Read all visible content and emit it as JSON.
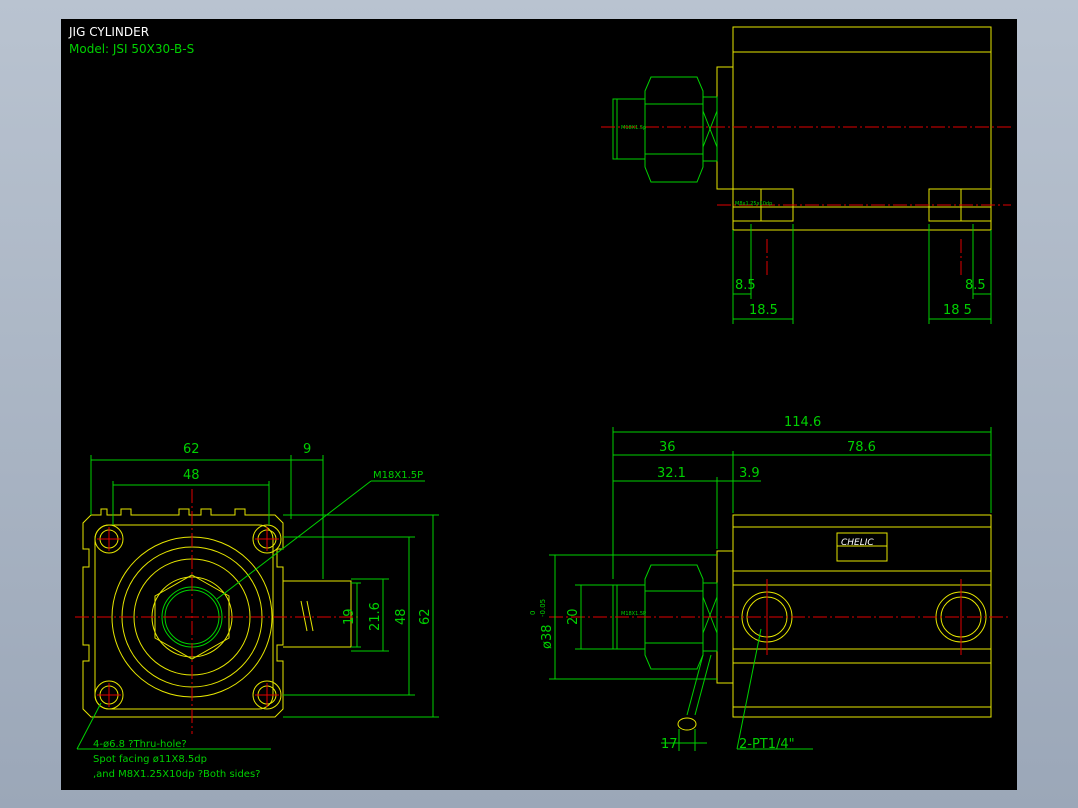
{
  "title": "JIG CYLINDER",
  "model": "Model: JSI 50X30-B-S",
  "side_view": {
    "dim_left_small": "8.5",
    "dim_left_big": "18.5",
    "dim_right_small": "8.5",
    "dim_right_big": "18 5",
    "rod_label": "M18X1.5p",
    "bolt_label": "M8x1.25x10dp"
  },
  "front_view": {
    "dim_62_top": "62",
    "dim_48_top": "48",
    "dim_9": "9",
    "thread_label": "M18X1.5P",
    "dim_19": "19",
    "dim_21_6": "21.6",
    "dim_48_side": "48",
    "dim_62_side": "62",
    "note_line1": "4-ø6.8   ?Thru-hole?",
    "note_line2": "Spot facing  ø11X8.5dp",
    "note_line3": ",and M8X1.25X10dp ?Both sides?"
  },
  "top_view": {
    "dim_total": "114.6",
    "dim_36": "36",
    "dim_78_6": "78.6",
    "dim_32_1": "32.1",
    "dim_3_9": "3.9",
    "dim_20": "20",
    "dim_dia38": "ø38",
    "tol_upper": "0",
    "tol_lower": "-0.05",
    "dim_17": "17",
    "port_label": "2-PT1/4\"",
    "brand": "CHELIC",
    "rod_label": "M18X1.5P"
  }
}
